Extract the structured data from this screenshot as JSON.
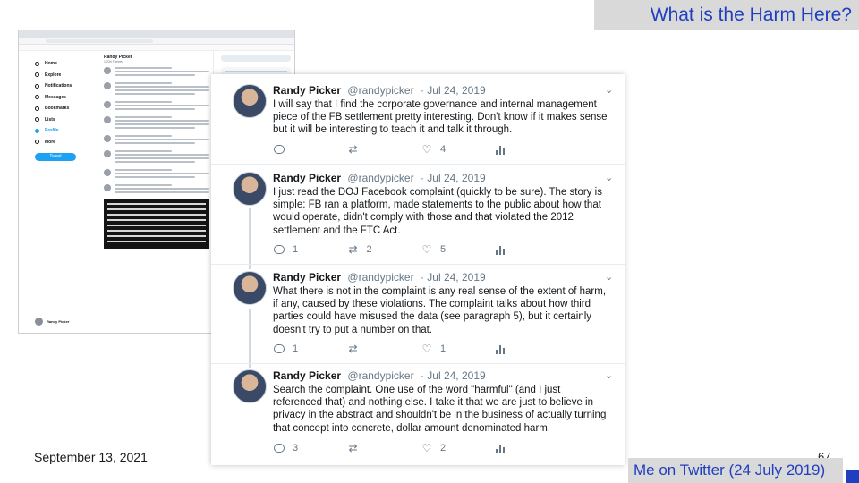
{
  "slide": {
    "title": "What is the Harm Here?",
    "date": "September 13, 2021",
    "page_number": "67",
    "caption": "Me on Twitter (24 July 2019)",
    "accent_color": "#1f3fbf"
  },
  "browser_bg": {
    "nav": [
      "Home",
      "Explore",
      "Notifications",
      "Messages",
      "Bookmarks",
      "Lists",
      "Profile",
      "More"
    ],
    "tweet_button": "Tweet",
    "profile_name": "Randy Picker",
    "profile_sub": "1,234 Tweets",
    "side_user": "Randy Picker"
  },
  "thread": {
    "tweets": [
      {
        "name": "Randy Picker",
        "handle": "@randypicker",
        "date": "· Jul 24, 2019",
        "text": "I will say that I find the corporate governance and internal management piece of the FB settlement pretty interesting. Don't know if it makes sense but it will be interesting to teach it and talk it through.",
        "replies": "",
        "retweets": "",
        "likes": "4"
      },
      {
        "name": "Randy Picker",
        "handle": "@randypicker",
        "date": "· Jul 24, 2019",
        "text": "I just read the DOJ Facebook complaint (quickly to be sure). The story is simple: FB ran a platform, made statements to the public about how that would operate, didn't comply with those and that violated the 2012 settlement and the FTC Act.",
        "replies": "1",
        "retweets": "2",
        "likes": "5"
      },
      {
        "name": "Randy Picker",
        "handle": "@randypicker",
        "date": "· Jul 24, 2019",
        "text": "What there is not in the complaint is any real sense of the extent of harm, if any, caused by these violations. The complaint talks about how third parties could have misused the data (see paragraph 5), but it certainly doesn't try to put a number on that.",
        "replies": "1",
        "retweets": "",
        "likes": "1"
      },
      {
        "name": "Randy Picker",
        "handle": "@randypicker",
        "date": "· Jul 24, 2019",
        "text": "Search the complaint. One use of the word \"harmful\" (and I just referenced that) and nothing else. I take it that we are just to believe in privacy in the abstract and shouldn't be in the business of actually turning that concept into concrete, dollar amount denominated harm.",
        "replies": "3",
        "retweets": "",
        "likes": "2"
      }
    ]
  }
}
